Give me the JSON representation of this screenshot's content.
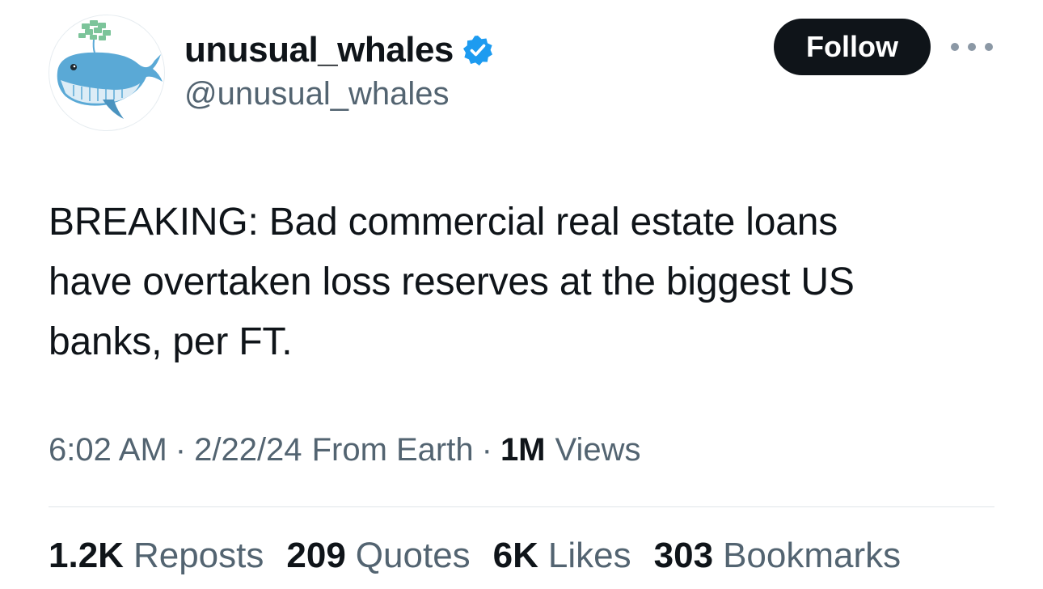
{
  "author": {
    "display_name": "unusual_whales",
    "handle": "@unusual_whales",
    "verified": true,
    "avatar": "whale-logo-avatar"
  },
  "actions": {
    "follow_label": "Follow",
    "more_icon": "more-dots-icon"
  },
  "tweet": {
    "text_line1": "BREAKING: Bad commercial real estate loans",
    "text_line2": "have overtaken loss reserves at the biggest US",
    "text_line3": "banks, per FT."
  },
  "meta": {
    "time": "6:02 AM",
    "date": "2/22/24",
    "source": "From Earth",
    "views_count": "1M",
    "views_label": "Views",
    "separator": "·"
  },
  "stats": {
    "reposts_count": "1.2K",
    "reposts_label": "Reposts",
    "quotes_count": "209",
    "quotes_label": "Quotes",
    "likes_count": "6K",
    "likes_label": "Likes",
    "bookmarks_count": "303",
    "bookmarks_label": "Bookmarks"
  },
  "colors": {
    "primary_text": "#0f1419",
    "secondary_text": "#536471",
    "verified_blue": "#1d9bf0",
    "follow_bg": "#0f1419",
    "whale_blue": "#5aa9d6",
    "money_green": "#7cc49a"
  }
}
